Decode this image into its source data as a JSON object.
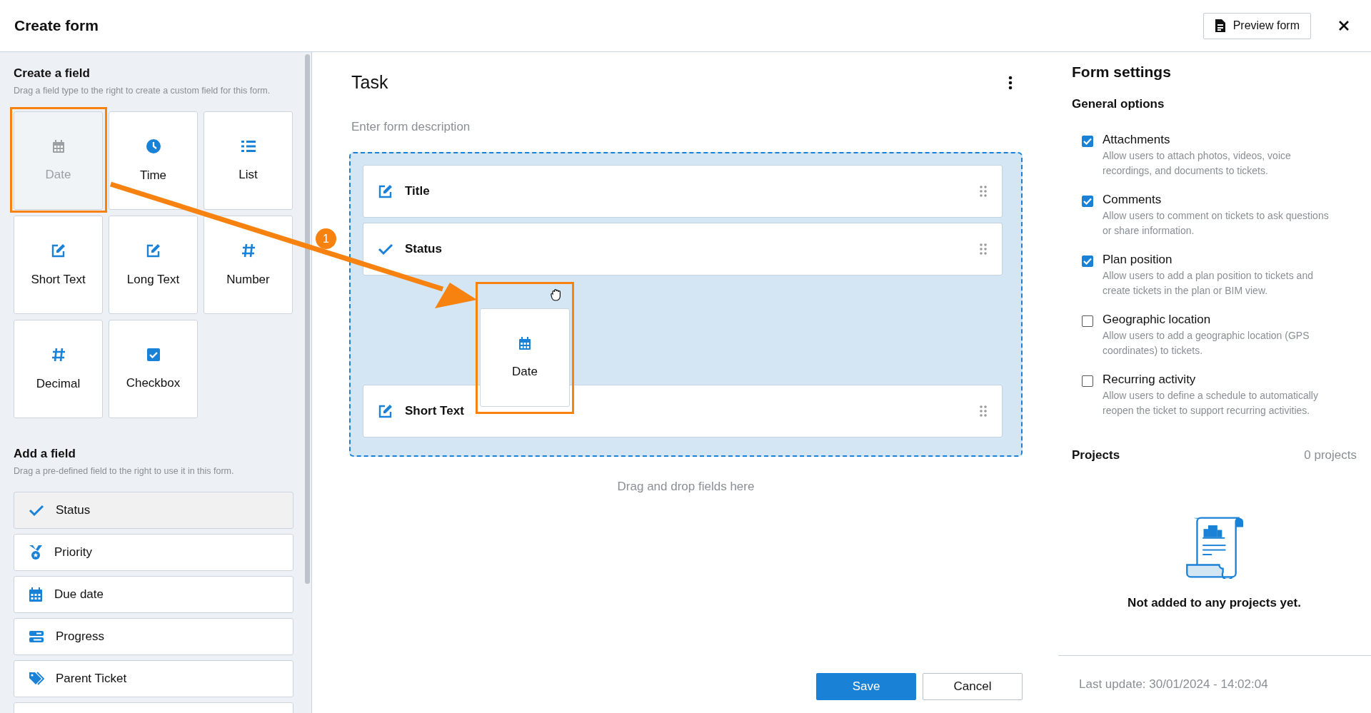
{
  "header": {
    "title": "Create form",
    "preview_button": "Preview form"
  },
  "create_field": {
    "title": "Create a field",
    "hint": "Drag a field type to the right to create a custom field for this form.",
    "tiles": [
      {
        "kind": "date",
        "label": "Date",
        "dragging": true
      },
      {
        "kind": "time",
        "label": "Time",
        "dragging": false
      },
      {
        "kind": "list",
        "label": "List",
        "dragging": false
      },
      {
        "kind": "short_text",
        "label": "Short Text",
        "dragging": false
      },
      {
        "kind": "long_text",
        "label": "Long Text",
        "dragging": false
      },
      {
        "kind": "number",
        "label": "Number",
        "dragging": false
      },
      {
        "kind": "decimal",
        "label": "Decimal",
        "dragging": false
      },
      {
        "kind": "checkbox",
        "label": "Checkbox",
        "dragging": false
      }
    ]
  },
  "add_field": {
    "title": "Add a field",
    "hint": "Drag a pre-defined field to the right to use it in this form.",
    "items": [
      {
        "kind": "status",
        "label": "Status",
        "disabled": true
      },
      {
        "kind": "priority",
        "label": "Priority",
        "disabled": false
      },
      {
        "kind": "due_date",
        "label": "Due date",
        "disabled": false
      },
      {
        "kind": "progress",
        "label": "Progress",
        "disabled": false
      },
      {
        "kind": "parent_ticket",
        "label": "Parent Ticket",
        "disabled": false
      },
      {
        "kind": "partial",
        "disabled": false
      }
    ]
  },
  "form": {
    "title": "Task",
    "description_placeholder": "Enter form description",
    "fields": [
      {
        "kind": "text",
        "label": "Title"
      },
      {
        "kind": "status",
        "label": "Status"
      },
      {
        "kind": "drop_gap"
      },
      {
        "kind": "text",
        "label": "Short Text"
      }
    ],
    "dragged_tile": {
      "kind": "date",
      "label": "Date"
    },
    "drop_hint": "Drag and drop fields here",
    "save_button": "Save",
    "cancel_button": "Cancel"
  },
  "annotation": {
    "step": "1"
  },
  "settings": {
    "title": "Form settings",
    "section": "General options",
    "options": [
      {
        "label": "Attachments",
        "description": "Allow users to attach photos, videos, voice recordings, and documents to tickets.",
        "checked": true
      },
      {
        "label": "Comments",
        "description": "Allow users to comment on tickets to ask questions or share information.",
        "checked": true
      },
      {
        "label": "Plan position",
        "description": "Allow users to add a plan position to tickets and create tickets in the plan or BIM view.",
        "checked": true
      },
      {
        "label": "Geographic location",
        "description": "Allow users to add a geographic location (GPS coordinates) to tickets.",
        "checked": false
      },
      {
        "label": "Recurring activity",
        "description": "Allow users to define a schedule to automatically reopen the ticket to support recurring activities.",
        "checked": false
      }
    ],
    "projects_title": "Projects",
    "projects_count": "0 projects",
    "empty_message": "Not added to any projects yet.",
    "last_update": "Last update: 30/01/2024 - 14:02:04"
  }
}
